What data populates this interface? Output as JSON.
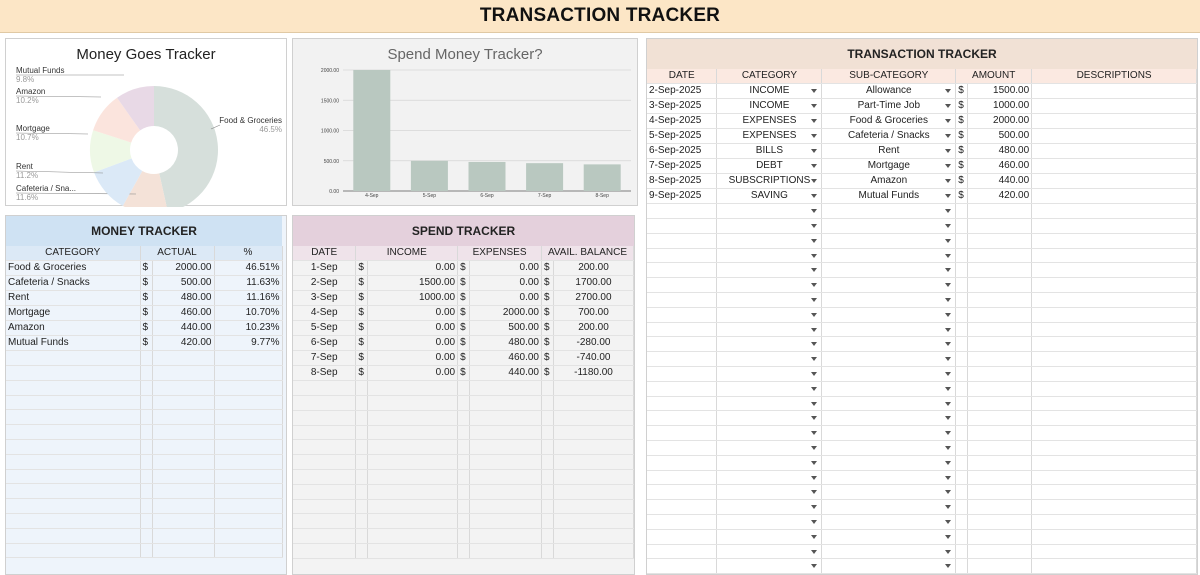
{
  "header": {
    "title": "TRANSACTION TRACKER"
  },
  "pie_chart": {
    "title": "Money Goes Tracker",
    "slices": [
      {
        "label": "Food & Groceries",
        "pct": "46.5%",
        "value": 46.5,
        "color": "#d6dfdb"
      },
      {
        "label": "Cafeteria / Sna...",
        "pct": "11.6%",
        "value": 11.6,
        "color": "#f4e2d8"
      },
      {
        "label": "Rent",
        "pct": "11.2%",
        "value": 11.2,
        "color": "#dbe9f7"
      },
      {
        "label": "Mortgage",
        "pct": "10.7%",
        "value": 10.7,
        "color": "#eef8e6"
      },
      {
        "label": "Amazon",
        "pct": "10.2%",
        "value": 10.2,
        "color": "#fbe4dd"
      },
      {
        "label": "Mutual Funds",
        "pct": "9.8%",
        "value": 9.8,
        "color": "#e8d9e6"
      }
    ]
  },
  "chart_data": {
    "type": "bar",
    "title": "Spend Money Tracker?",
    "categories": [
      "4-Sep",
      "5-Sep",
      "6-Sep",
      "7-Sep",
      "8-Sep"
    ],
    "values": [
      2000,
      500,
      480,
      460,
      440
    ],
    "ylim": [
      0,
      2000
    ],
    "yticks": [
      "0.00",
      "500.00",
      "1000.00",
      "1500.00",
      "2000.00"
    ],
    "bar_color": "#b9c8c0",
    "grid": true
  },
  "money_tracker": {
    "title": "MONEY TRACKER",
    "columns": [
      "CATEGORY",
      "ACTUAL",
      "%"
    ],
    "currency": "$",
    "rows": [
      {
        "category": "Food & Groceries",
        "actual": "2000.00",
        "pct": "46.51%"
      },
      {
        "category": "Cafeteria / Snacks",
        "actual": "500.00",
        "pct": "11.63%"
      },
      {
        "category": "Rent",
        "actual": "480.00",
        "pct": "11.16%"
      },
      {
        "category": "Mortgage",
        "actual": "460.00",
        "pct": "10.70%"
      },
      {
        "category": "Amazon",
        "actual": "440.00",
        "pct": "10.23%"
      },
      {
        "category": "Mutual Funds",
        "actual": "420.00",
        "pct": "9.77%"
      }
    ]
  },
  "spend_tracker": {
    "title": "SPEND TRACKER",
    "columns": [
      "DATE",
      "INCOME",
      "EXPENSES",
      "AVAIL. BALANCE"
    ],
    "currency": "$",
    "rows": [
      {
        "date": "1-Sep",
        "income": "0.00",
        "expenses": "0.00",
        "balance": "200.00"
      },
      {
        "date": "2-Sep",
        "income": "1500.00",
        "expenses": "0.00",
        "balance": "1700.00"
      },
      {
        "date": "3-Sep",
        "income": "1000.00",
        "expenses": "0.00",
        "balance": "2700.00"
      },
      {
        "date": "4-Sep",
        "income": "0.00",
        "expenses": "2000.00",
        "balance": "700.00"
      },
      {
        "date": "5-Sep",
        "income": "0.00",
        "expenses": "500.00",
        "balance": "200.00"
      },
      {
        "date": "6-Sep",
        "income": "0.00",
        "expenses": "480.00",
        "balance": "-280.00"
      },
      {
        "date": "7-Sep",
        "income": "0.00",
        "expenses": "460.00",
        "balance": "-740.00"
      },
      {
        "date": "8-Sep",
        "income": "0.00",
        "expenses": "440.00",
        "balance": "-1180.00"
      }
    ]
  },
  "transaction_tracker": {
    "title": "TRANSACTION TRACKER",
    "columns": [
      "DATE",
      "CATEGORY",
      "SUB-CATEGORY",
      "AMOUNT",
      "DESCRIPTIONS"
    ],
    "currency": "$",
    "rows": [
      {
        "date": "2-Sep-2025",
        "category": "INCOME",
        "sub": "Allowance",
        "amount": "1500.00"
      },
      {
        "date": "3-Sep-2025",
        "category": "INCOME",
        "sub": "Part-Time Job",
        "amount": "1000.00"
      },
      {
        "date": "4-Sep-2025",
        "category": "EXPENSES",
        "sub": "Food & Groceries",
        "amount": "2000.00"
      },
      {
        "date": "5-Sep-2025",
        "category": "EXPENSES",
        "sub": "Cafeteria / Snacks",
        "amount": "500.00"
      },
      {
        "date": "6-Sep-2025",
        "category": "BILLS",
        "sub": "Rent",
        "amount": "480.00"
      },
      {
        "date": "7-Sep-2025",
        "category": "DEBT",
        "sub": "Mortgage",
        "amount": "460.00"
      },
      {
        "date": "8-Sep-2025",
        "category": "SUBSCRIPTIONS",
        "sub": "Amazon",
        "amount": "440.00"
      },
      {
        "date": "9-Sep-2025",
        "category": "SAVING",
        "sub": "Mutual Funds",
        "amount": "420.00"
      }
    ]
  },
  "colors": {
    "title_bg": "#fce6c6",
    "money_header": "#cfe2f3",
    "money_col_header": "#dce9f6",
    "spend_header": "#e4d0dc",
    "spend_col_header": "#efe3ea",
    "tx_header": "#f1e1d5",
    "tx_col_header": "#fbe9e1"
  }
}
